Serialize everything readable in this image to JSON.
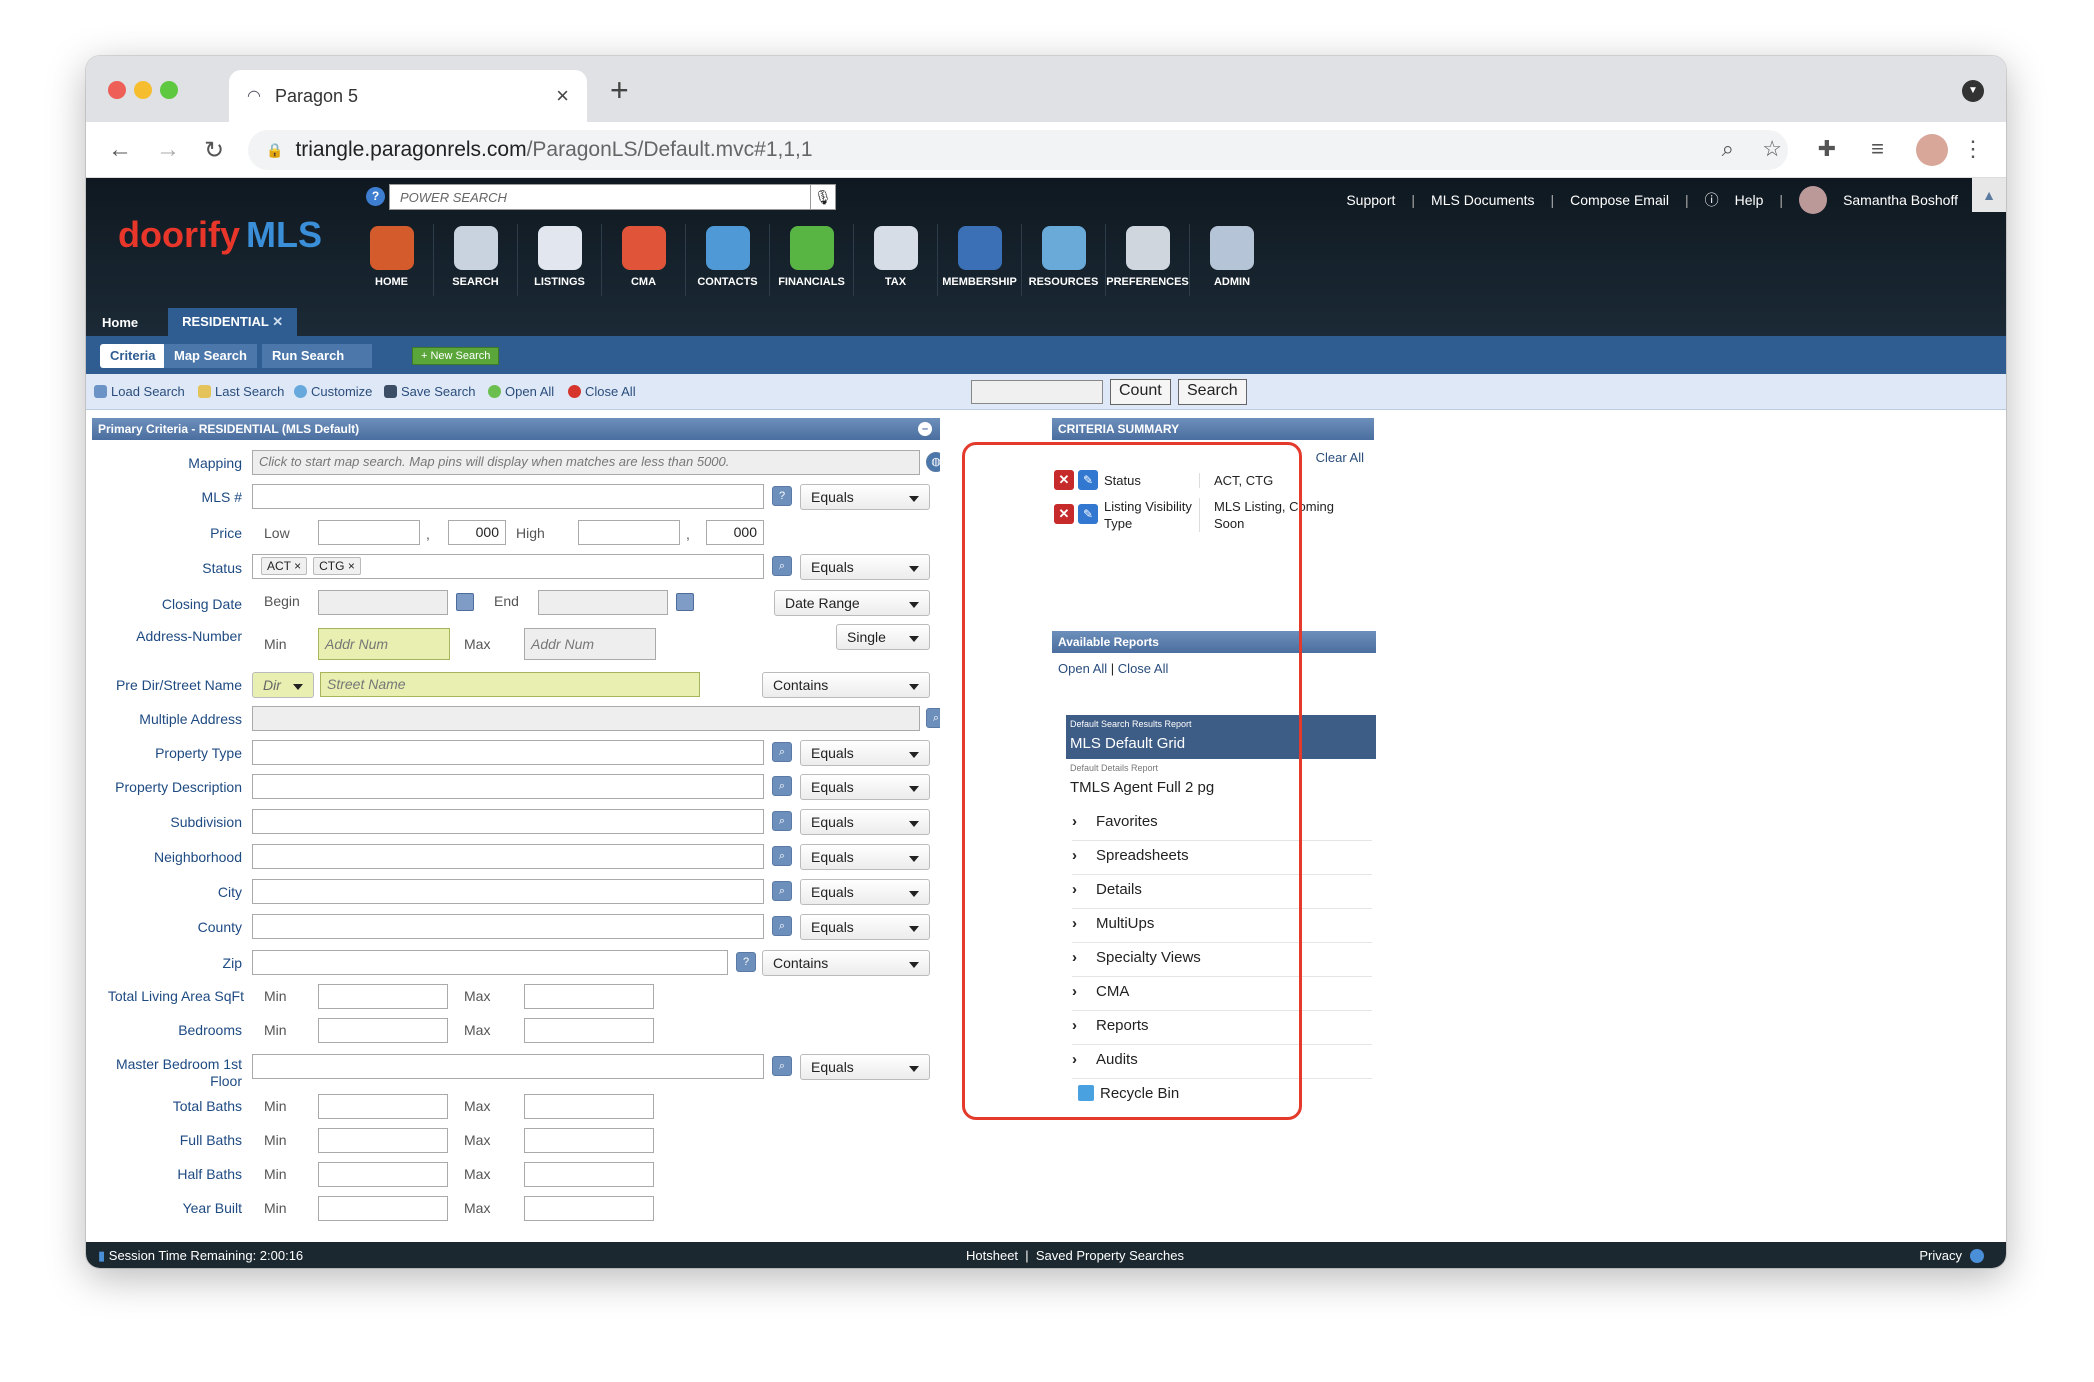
{
  "browser": {
    "tab_title": "Paragon 5",
    "url_host": "triangle.paragonrels.com",
    "url_path": "/ParagonLS/Default.mvc#1,1,1"
  },
  "header": {
    "power_search_placeholder": "POWER SEARCH",
    "top_links": [
      "Support",
      "MLS Documents",
      "Compose Email",
      "Help"
    ],
    "user_name": "Samantha Boshoff",
    "logo_text": "doorify",
    "logo_mls": "MLS",
    "modules": [
      "HOME",
      "SEARCH",
      "LISTINGS",
      "CMA",
      "CONTACTS",
      "FINANCIALS",
      "TAX",
      "MEMBERSHIP",
      "RESOURCES",
      "PREFERENCES",
      "ADMIN"
    ]
  },
  "tabs": {
    "home": "Home",
    "residential": "RESIDENTIAL"
  },
  "subnav": {
    "criteria": "Criteria",
    "map_search": "Map Search",
    "run_search": "Run Search",
    "new_search": "+ New Search"
  },
  "actions": {
    "load_search": "Load Search",
    "last_search": "Last Search",
    "customize": "Customize",
    "save_search": "Save Search",
    "open_all": "Open All",
    "close_all": "Close All",
    "count": "Count",
    "search": "Search"
  },
  "primary": {
    "title": "Primary Criteria - RESIDENTIAL (MLS Default)",
    "mapping_label": "Mapping",
    "mapping_placeholder": "Click to start map search. Map pins will display when matches are less than 5000.",
    "mls_label": "MLS #",
    "price_label": "Price",
    "low": "Low",
    "high": "High",
    "thousands": "000",
    "comma": ",",
    "status_label": "Status",
    "status_chips": [
      "ACT",
      "CTG"
    ],
    "closing_label": "Closing Date",
    "begin": "Begin",
    "end": "End",
    "date_range": "Date Range",
    "addr_label": "Address-Number",
    "min": "Min",
    "max": "Max",
    "addr_placeholder": "Addr Num",
    "single": "Single",
    "street_label": "Pre Dir/Street Name",
    "dir": "Dir",
    "street_placeholder": "Street Name",
    "multiple_label": "Multiple Address",
    "equals": "Equals",
    "contains": "Contains",
    "fields": [
      "Property Type",
      "Property Description",
      "Subdivision",
      "Neighborhood",
      "City",
      "County"
    ],
    "zip_label": "Zip",
    "sqft_label": "Total Living Area SqFt",
    "bedrooms_label": "Bedrooms",
    "master_label": "Master Bedroom 1st",
    "master_label2": "Floor",
    "range_fields": [
      "Total Baths",
      "Full Baths",
      "Half Baths",
      "Year Built"
    ]
  },
  "summary": {
    "title": "CRITERIA SUMMARY",
    "clear_all": "Clear All",
    "rows": [
      {
        "key": "Status",
        "value": "ACT, CTG"
      },
      {
        "key": "Listing Visibility Type",
        "value": "MLS Listing, Coming Soon"
      }
    ]
  },
  "reports": {
    "title": "Available Reports",
    "open_all": "Open All",
    "close_all": "Close All",
    "grid_small": "Default Search Results Report",
    "grid_name": "MLS Default Grid",
    "details_small": "Default Details Report",
    "details_name": "TMLS Agent Full 2 pg",
    "folders": [
      "Favorites",
      "Spreadsheets",
      "Details",
      "MultiUps",
      "Specialty Views",
      "CMA",
      "Reports",
      "Audits"
    ],
    "recycle": "Recycle Bin"
  },
  "footer": {
    "session": "Session Time Remaining: 2:00:16",
    "hotsheet": "Hotsheet",
    "saved": "Saved Property Searches",
    "privacy": "Privacy"
  },
  "colors": {
    "accent": "#2f5d92",
    "highlight_ring": "#e43a2b",
    "brand_red": "#e8362a",
    "brand_blue": "#3a8fd8"
  }
}
